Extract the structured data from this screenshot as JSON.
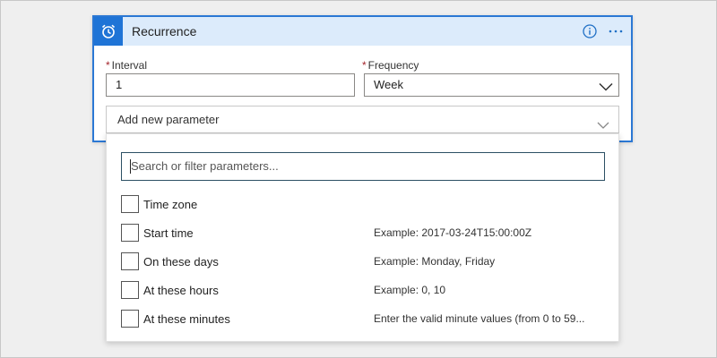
{
  "card": {
    "title": "Recurrence",
    "trigger_icon": "alarm-clock-icon",
    "info_icon": "info-icon",
    "more_icon": "more-options-icon",
    "accent": "#2b78d4",
    "header_bg": "#dcebfb"
  },
  "fields": {
    "interval": {
      "required_mark": "*",
      "label": "Interval",
      "value": "1"
    },
    "frequency": {
      "required_mark": "*",
      "label": "Frequency",
      "value": "Week"
    }
  },
  "add_parameter": {
    "label": "Add new parameter"
  },
  "panel": {
    "search_placeholder": "Search or filter parameters...",
    "parameters": [
      {
        "name": "Time zone",
        "example": ""
      },
      {
        "name": "Start time",
        "example": "Example: 2017-03-24T15:00:00Z"
      },
      {
        "name": "On these days",
        "example": "Example: Monday, Friday"
      },
      {
        "name": "At these hours",
        "example": "Example: 0, 10"
      },
      {
        "name": "At these minutes",
        "example": "Enter the valid minute values (from 0 to 59..."
      }
    ]
  }
}
